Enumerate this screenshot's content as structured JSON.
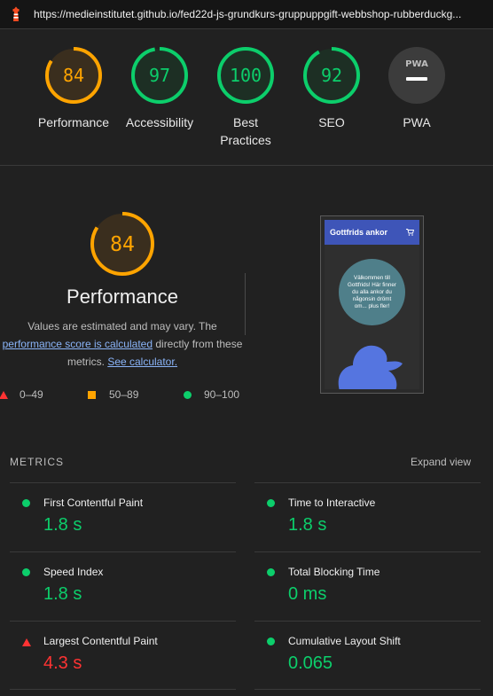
{
  "topbar": {
    "url": "https://medieinstitutet.github.io/fed22d-js-grundkurs-gruppuppgift-webbshop-rubberduckg..."
  },
  "gauges": [
    {
      "score": "84",
      "label": "Performance",
      "color": "#ffa400",
      "fraction": 0.84
    },
    {
      "score": "97",
      "label": "Accessibility",
      "color": "#0cce6b",
      "fraction": 0.97
    },
    {
      "score": "100",
      "label_line1": "Best",
      "label_line2": "Practices",
      "color": "#0cce6b",
      "fraction": 1.0
    },
    {
      "score": "92",
      "label": "SEO",
      "color": "#0cce6b",
      "fraction": 0.92
    },
    {
      "badge": "PWA",
      "label": "PWA",
      "color": "#9e9e9e"
    }
  ],
  "performance": {
    "score": "84",
    "fraction": 0.84,
    "title": "Performance",
    "desc_line1": "Values are estimated and may vary. The",
    "desc_link1": "performance score is calculated",
    "desc_mid": " directly from these",
    "desc_line3_prefix": "metrics. ",
    "desc_link2": "See calculator."
  },
  "legend": {
    "range_bad": "0–49",
    "range_avg": "50–89",
    "range_good": "90–100"
  },
  "screenshot": {
    "site_name": "Gottfrids ankor",
    "cart_icon": "cart-icon",
    "welcome_text": "Välkommen till Gottfrids! Här finner du alla ankor du någonsin drömt om... plus fler!"
  },
  "metrics": {
    "heading": "METRICS",
    "expand_label": "Expand view",
    "items": [
      {
        "title": "First Contentful Paint",
        "value": "1.8 s",
        "status": "good"
      },
      {
        "title": "Time to Interactive",
        "value": "1.8 s",
        "status": "good"
      },
      {
        "title": "Speed Index",
        "value": "1.8 s",
        "status": "good"
      },
      {
        "title": "Total Blocking Time",
        "value": "0 ms",
        "status": "good"
      },
      {
        "title": "Largest Contentful Paint",
        "value": "4.3 s",
        "status": "bad"
      },
      {
        "title": "Cumulative Layout Shift",
        "value": "0.065",
        "status": "good"
      }
    ]
  },
  "colors": {
    "good": "#0cce6b",
    "average": "#ffa400",
    "bad": "#ff3333",
    "link": "#8ab4f8"
  }
}
